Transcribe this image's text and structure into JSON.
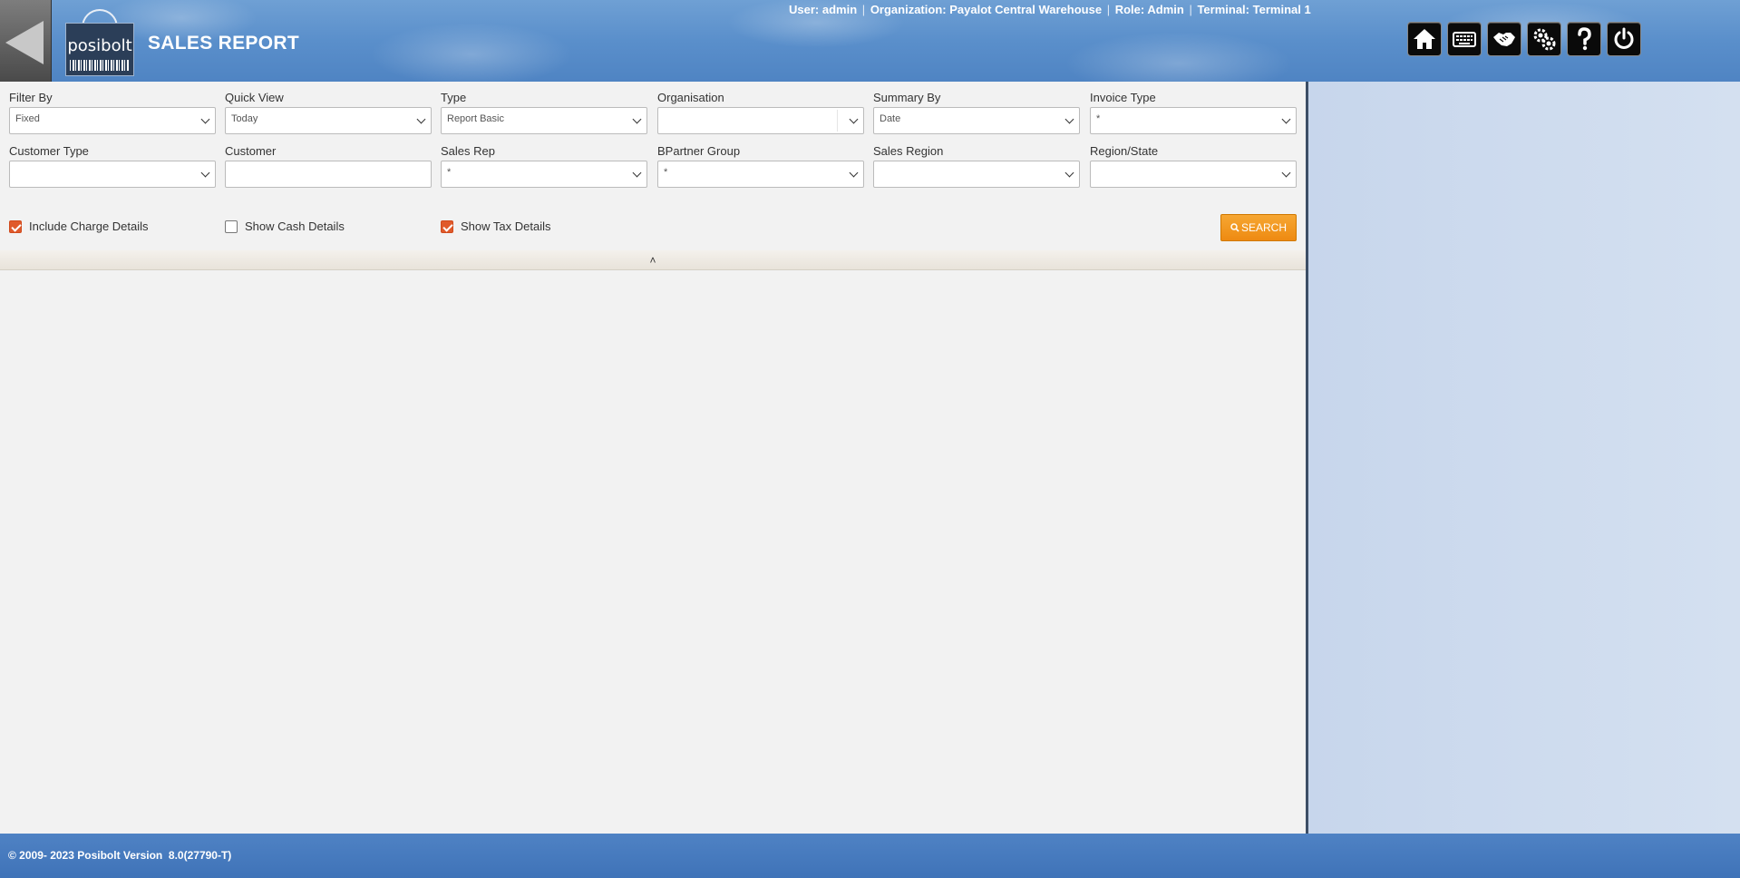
{
  "header": {
    "title": "SALES REPORT",
    "logo_text": "posibolt",
    "user_label": "User:",
    "user": "admin",
    "org_label": "Organization:",
    "org": "Payalot Central Warehouse",
    "role_label": "Role:",
    "role": "Admin",
    "terminal_label": "Terminal:",
    "terminal": "Terminal 1",
    "separator": "|"
  },
  "filters": {
    "filter_by": {
      "label": "Filter By",
      "value": "Fixed"
    },
    "quick_view": {
      "label": "Quick View",
      "value": "Today"
    },
    "type": {
      "label": "Type",
      "value": "Report Basic"
    },
    "organisation": {
      "label": "Organisation",
      "value": ""
    },
    "summary_by": {
      "label": "Summary By",
      "value": "Date"
    },
    "invoice_type": {
      "label": "Invoice Type",
      "value": "*"
    },
    "customer_type": {
      "label": "Customer Type",
      "value": ""
    },
    "customer": {
      "label": "Customer",
      "value": ""
    },
    "sales_rep": {
      "label": "Sales Rep",
      "value": "*"
    },
    "bpartner_group": {
      "label": "BPartner Group",
      "value": "*"
    },
    "sales_region": {
      "label": "Sales Region",
      "value": ""
    },
    "region_state": {
      "label": "Region/State",
      "value": ""
    }
  },
  "checkboxes": {
    "charge": {
      "label": "Include Charge Details",
      "checked": true
    },
    "cash": {
      "label": "Show Cash Details",
      "checked": false
    },
    "tax": {
      "label": "Show Tax Details",
      "checked": true
    }
  },
  "search_label": "SEARCH",
  "collapse_icon": "double-chevron-up",
  "footer": {
    "copyright": "© 2009- 2023 Posibolt Version  8.0(27790-T)"
  },
  "colors": {
    "accent": "#ee8a11",
    "check": "#e05a2b",
    "header": "#5a8fcb"
  }
}
